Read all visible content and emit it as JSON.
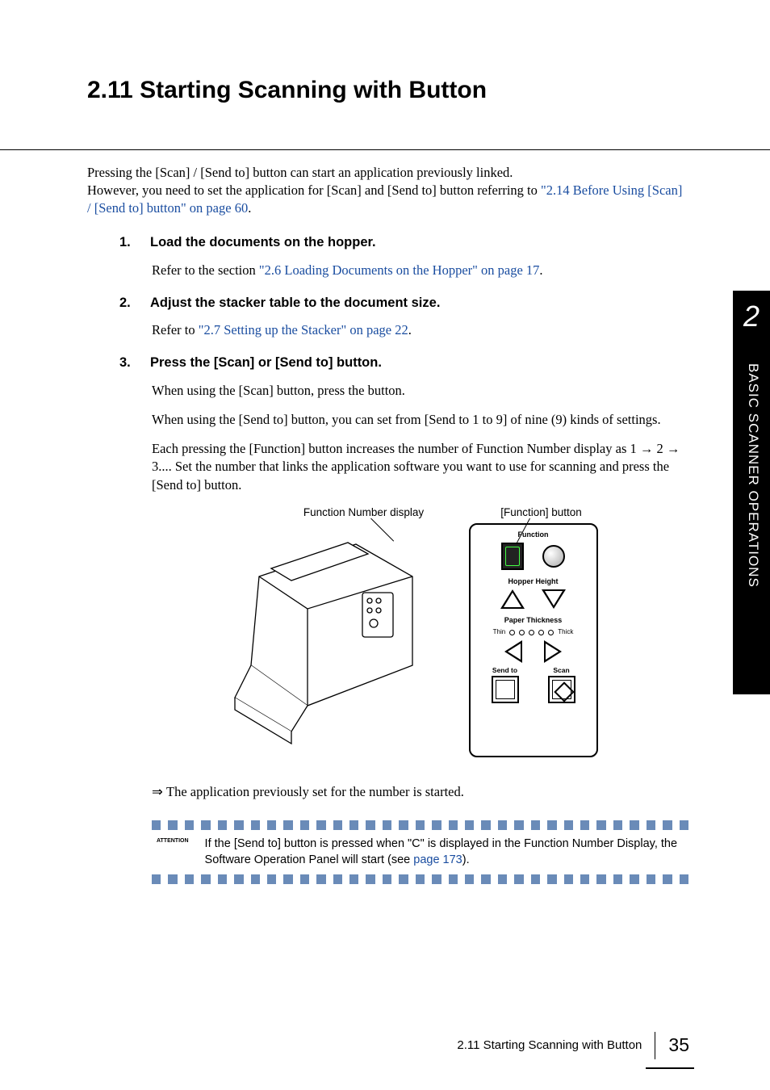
{
  "heading": "2.11 Starting Scanning with Button",
  "intro": {
    "p1": "Pressing the [Scan] / [Send to] button can start an application previously linked.",
    "p2a": "However, you need to set the application for [Scan] and [Send to] button referring to ",
    "p2link": "\"2.14 Before Using [Scan] / [Send to] button\" on page 60",
    "p2b": "."
  },
  "steps": [
    {
      "num": "1.",
      "title": "Load the documents on the hopper.",
      "body_pre": "Refer to the section ",
      "body_link": "\"2.6 Loading Documents on the Hopper\" on page 17",
      "body_post": "."
    },
    {
      "num": "2.",
      "title": "Adjust the stacker table to the document size.",
      "body_pre": "Refer to ",
      "body_link": "\"2.7 Setting up the Stacker\" on page 22",
      "body_post": "."
    },
    {
      "num": "3.",
      "title": "Press the [Scan] or [Send to] button.",
      "p1": "When using the [Scan] button, press the button.",
      "p2": "When using the [Send to] button, you can set from [Send to 1 to 9] of nine (9) kinds of settings.",
      "p3": "Each pressing the [Function] button increases the number of Function Number display as 1 → 2 → 3.... Set the number that links the application software you want to use for scanning and press the [Send to] button."
    }
  ],
  "diagram": {
    "label_left": "Function Number display",
    "label_right": "[Function] button",
    "panel": {
      "function": "Function",
      "hopper": "Hopper Height",
      "thickness": "Paper Thickness",
      "thin": "Thin",
      "thick": "Thick",
      "sendto": "Send to",
      "scan": "Scan"
    }
  },
  "result": "The application previously set for the number is started.",
  "attention": {
    "label": "ATTENTION",
    "text_a": "If the [Send to] button is pressed when \"C\" is displayed in the Function Number Display, the Software Operation Panel will start (see ",
    "link": "page 173",
    "text_b": ")."
  },
  "side": {
    "num": "2",
    "text": "BASIC SCANNER OPERATIONS"
  },
  "footer": {
    "title": "2.11 Starting Scanning with Button",
    "page": "35"
  }
}
